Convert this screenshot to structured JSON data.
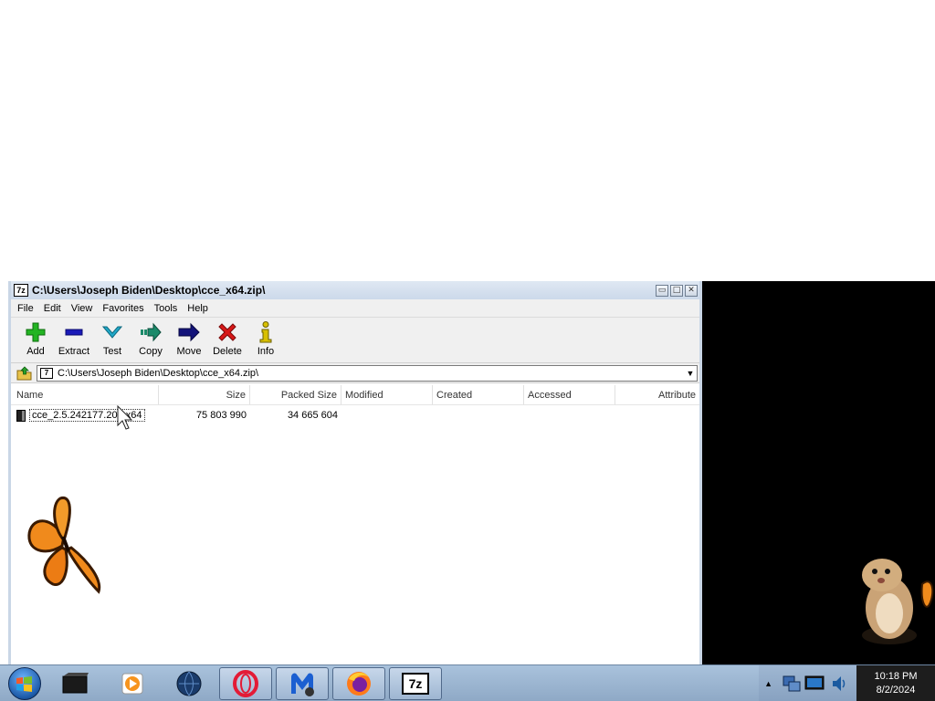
{
  "window": {
    "title": "C:\\Users\\Joseph Biden\\Desktop\\cce_x64.zip\\",
    "app_icon_text": "7z",
    "minimize_glyph": "▭",
    "maximize_glyph": "□",
    "close_glyph": "✕"
  },
  "menu": [
    "File",
    "Edit",
    "View",
    "Favorites",
    "Tools",
    "Help"
  ],
  "toolbar": [
    {
      "label": "Add",
      "icon": "add-plus-icon",
      "color": "#22b422"
    },
    {
      "label": "Extract",
      "icon": "extract-minus-icon",
      "color": "#1a1ab8"
    },
    {
      "label": "Test",
      "icon": "test-check-icon",
      "color": "#20a8c8"
    },
    {
      "label": "Copy",
      "icon": "copy-arrow-icon",
      "color": "#1a8a6a"
    },
    {
      "label": "Move",
      "icon": "move-arrow-icon",
      "color": "#14147a"
    },
    {
      "label": "Delete",
      "icon": "delete-x-icon",
      "color": "#d81818"
    },
    {
      "label": "Info",
      "icon": "info-icon",
      "color": "#d8c000"
    }
  ],
  "address": {
    "path": "C:\\Users\\Joseph Biden\\Desktop\\cce_x64.zip\\"
  },
  "columns": [
    "Name",
    "Size",
    "Packed Size",
    "Modified",
    "Created",
    "Accessed",
    "Attribute"
  ],
  "files": [
    {
      "name": "cce_2.5.242177.201 x64",
      "size": "75 803 990",
      "packed": "34 665 604"
    }
  ],
  "taskbar": {
    "app_7z_text": "7z"
  },
  "clock": {
    "time": "10:18 PM",
    "date": "8/2/2024"
  }
}
